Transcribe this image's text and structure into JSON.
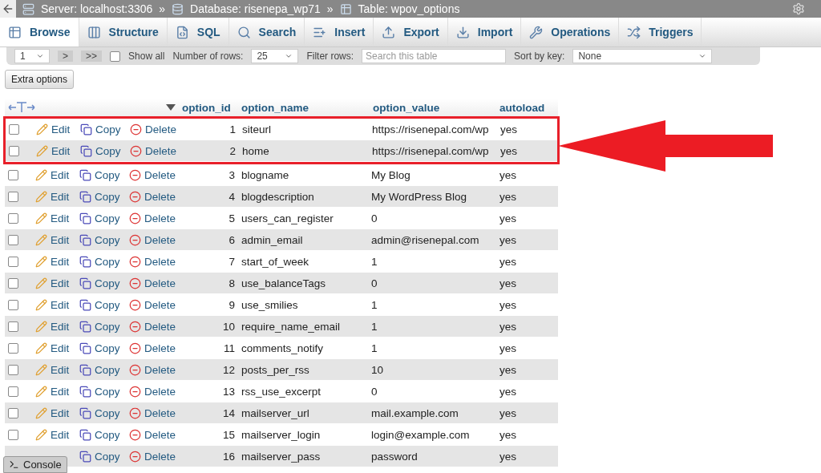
{
  "breadcrumbs": [
    {
      "kind": "server",
      "label": "Server: localhost:3306"
    },
    {
      "kind": "database",
      "label": "Database: risenepa_wp71"
    },
    {
      "kind": "table",
      "label": "Table: wpov_options"
    }
  ],
  "separator": "»",
  "tabs": [
    {
      "kind": "browse",
      "label": "Browse",
      "selected": true
    },
    {
      "kind": "structure",
      "label": "Structure",
      "selected": false
    },
    {
      "kind": "sql",
      "label": "SQL",
      "selected": false
    },
    {
      "kind": "search",
      "label": "Search",
      "selected": false
    },
    {
      "kind": "insert",
      "label": "Insert",
      "selected": false
    },
    {
      "kind": "export",
      "label": "Export",
      "selected": false
    },
    {
      "kind": "import",
      "label": "Import",
      "selected": false
    },
    {
      "kind": "operations",
      "label": "Operations",
      "selected": false
    },
    {
      "kind": "triggers",
      "label": "Triggers",
      "selected": false
    }
  ],
  "toolbar": {
    "page": "1",
    "nav_buttons": [
      ">",
      ">>"
    ],
    "show_all": {
      "label": "Show all",
      "checked": false
    },
    "rows_label": "Number of rows:",
    "rows_value": "25",
    "filter_label": "Filter rows:",
    "filter_placeholder": "Search this table",
    "sort_label": "Sort by key:",
    "sort_value": "None"
  },
  "extra_options": "Extra options",
  "table": {
    "columns": [
      "option_id",
      "option_name",
      "option_value",
      "autoload"
    ],
    "rows": [
      {
        "id": "1",
        "name": "siteurl",
        "value": "https://risenepal.com/wp",
        "autoload": "yes",
        "highlighted": true,
        "checked": false,
        "actions": [
          {
            "kind": "edit",
            "label": "Edit"
          },
          {
            "kind": "copy",
            "label": "Copy"
          },
          {
            "kind": "delete",
            "label": "Delete"
          }
        ]
      },
      {
        "id": "2",
        "name": "home",
        "value": "https://risenepal.com/wp",
        "autoload": "yes",
        "highlighted": true,
        "checked": false,
        "actions": [
          {
            "kind": "edit",
            "label": "Edit"
          },
          {
            "kind": "copy",
            "label": "Copy"
          },
          {
            "kind": "delete",
            "label": "Delete"
          }
        ]
      },
      {
        "id": "3",
        "name": "blogname",
        "value": "My Blog",
        "autoload": "yes",
        "highlighted": false,
        "checked": false,
        "actions": [
          {
            "kind": "edit",
            "label": "Edit"
          },
          {
            "kind": "copy",
            "label": "Copy"
          },
          {
            "kind": "delete",
            "label": "Delete"
          }
        ]
      },
      {
        "id": "4",
        "name": "blogdescription",
        "value": "My WordPress Blog",
        "autoload": "yes",
        "highlighted": false,
        "checked": false,
        "actions": [
          {
            "kind": "edit",
            "label": "Edit"
          },
          {
            "kind": "copy",
            "label": "Copy"
          },
          {
            "kind": "delete",
            "label": "Delete"
          }
        ]
      },
      {
        "id": "5",
        "name": "users_can_register",
        "value": "0",
        "autoload": "yes",
        "highlighted": false,
        "checked": false,
        "actions": [
          {
            "kind": "edit",
            "label": "Edit"
          },
          {
            "kind": "copy",
            "label": "Copy"
          },
          {
            "kind": "delete",
            "label": "Delete"
          }
        ]
      },
      {
        "id": "6",
        "name": "admin_email",
        "value": "admin@risenepal.com",
        "autoload": "yes",
        "highlighted": false,
        "checked": false,
        "actions": [
          {
            "kind": "edit",
            "label": "Edit"
          },
          {
            "kind": "copy",
            "label": "Copy"
          },
          {
            "kind": "delete",
            "label": "Delete"
          }
        ]
      },
      {
        "id": "7",
        "name": "start_of_week",
        "value": "1",
        "autoload": "yes",
        "highlighted": false,
        "checked": false,
        "actions": [
          {
            "kind": "edit",
            "label": "Edit"
          },
          {
            "kind": "copy",
            "label": "Copy"
          },
          {
            "kind": "delete",
            "label": "Delete"
          }
        ]
      },
      {
        "id": "8",
        "name": "use_balanceTags",
        "value": "0",
        "autoload": "yes",
        "highlighted": false,
        "checked": false,
        "actions": [
          {
            "kind": "edit",
            "label": "Edit"
          },
          {
            "kind": "copy",
            "label": "Copy"
          },
          {
            "kind": "delete",
            "label": "Delete"
          }
        ]
      },
      {
        "id": "9",
        "name": "use_smilies",
        "value": "1",
        "autoload": "yes",
        "highlighted": false,
        "checked": false,
        "actions": [
          {
            "kind": "edit",
            "label": "Edit"
          },
          {
            "kind": "copy",
            "label": "Copy"
          },
          {
            "kind": "delete",
            "label": "Delete"
          }
        ]
      },
      {
        "id": "10",
        "name": "require_name_email",
        "value": "1",
        "autoload": "yes",
        "highlighted": false,
        "checked": false,
        "actions": [
          {
            "kind": "edit",
            "label": "Edit"
          },
          {
            "kind": "copy",
            "label": "Copy"
          },
          {
            "kind": "delete",
            "label": "Delete"
          }
        ]
      },
      {
        "id": "11",
        "name": "comments_notify",
        "value": "1",
        "autoload": "yes",
        "highlighted": false,
        "checked": false,
        "actions": [
          {
            "kind": "edit",
            "label": "Edit"
          },
          {
            "kind": "copy",
            "label": "Copy"
          },
          {
            "kind": "delete",
            "label": "Delete"
          }
        ]
      },
      {
        "id": "12",
        "name": "posts_per_rss",
        "value": "10",
        "autoload": "yes",
        "highlighted": false,
        "checked": false,
        "actions": [
          {
            "kind": "edit",
            "label": "Edit"
          },
          {
            "kind": "copy",
            "label": "Copy"
          },
          {
            "kind": "delete",
            "label": "Delete"
          }
        ]
      },
      {
        "id": "13",
        "name": "rss_use_excerpt",
        "value": "0",
        "autoload": "yes",
        "highlighted": false,
        "checked": false,
        "actions": [
          {
            "kind": "edit",
            "label": "Edit"
          },
          {
            "kind": "copy",
            "label": "Copy"
          },
          {
            "kind": "delete",
            "label": "Delete"
          }
        ]
      },
      {
        "id": "14",
        "name": "mailserver_url",
        "value": "mail.example.com",
        "autoload": "yes",
        "highlighted": false,
        "checked": false,
        "actions": [
          {
            "kind": "edit",
            "label": "Edit"
          },
          {
            "kind": "copy",
            "label": "Copy"
          },
          {
            "kind": "delete",
            "label": "Delete"
          }
        ]
      },
      {
        "id": "15",
        "name": "mailserver_login",
        "value": "login@example.com",
        "autoload": "yes",
        "highlighted": false,
        "checked": false,
        "actions": [
          {
            "kind": "edit",
            "label": "Edit"
          },
          {
            "kind": "copy",
            "label": "Copy"
          },
          {
            "kind": "delete",
            "label": "Delete"
          }
        ]
      },
      {
        "id": "16",
        "name": "mailserver_pass",
        "value": "password",
        "autoload": "yes",
        "highlighted": false,
        "actions": [
          {
            "kind": "copy",
            "label": "Copy"
          },
          {
            "kind": "delete",
            "label": "Delete"
          }
        ]
      }
    ]
  },
  "console": "Console"
}
